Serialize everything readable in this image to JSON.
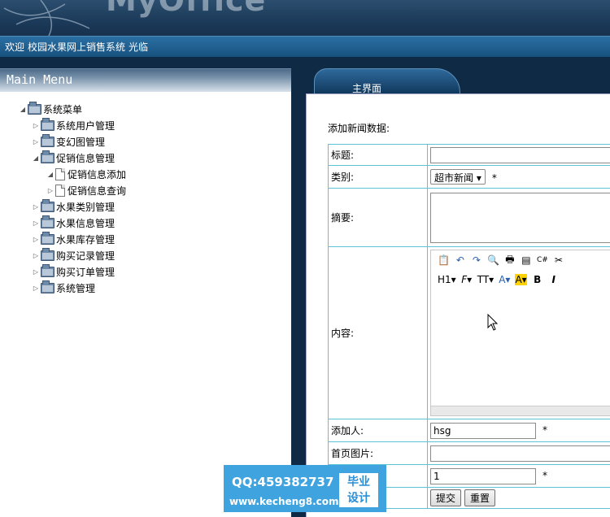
{
  "header": {
    "logo_text": "MyOffice"
  },
  "welcome": {
    "prefix": "欢迎",
    "system": "校园水果网上销售系统",
    "suffix": "光临"
  },
  "menu": {
    "title": "Main Menu",
    "root": "系统菜单",
    "items": [
      {
        "label": "系统用户管理",
        "expanded": false
      },
      {
        "label": "变幻图管理",
        "expanded": false
      },
      {
        "label": "促销信息管理",
        "expanded": true,
        "children": [
          "促销信息添加",
          "促销信息查询"
        ]
      },
      {
        "label": "水果类别管理",
        "expanded": false
      },
      {
        "label": "水果信息管理",
        "expanded": false
      },
      {
        "label": "水果库存管理",
        "expanded": false
      },
      {
        "label": "购买记录管理",
        "expanded": false
      },
      {
        "label": "购买订单管理",
        "expanded": false
      },
      {
        "label": "系统管理",
        "expanded": false
      }
    ]
  },
  "tab": {
    "label": "主界面"
  },
  "form": {
    "caption": "添加新闻数据:",
    "title_label": "标题:",
    "title_value": "",
    "category_label": "类别:",
    "category_value": "超市新闻",
    "summary_label": "摘要:",
    "content_label": "内容:",
    "adder_label": "添加人:",
    "adder_value": "hsg",
    "image_label": "首页图片:",
    "image_value": "",
    "order_value": "1",
    "required_mark": "*",
    "submit_label": "提交",
    "reset_label": "重置"
  },
  "editor": {
    "row2": {
      "heading": "H1",
      "font": "F",
      "size": "TT",
      "font_color": "A",
      "highlight": "A",
      "bold": "B",
      "italic": "I"
    }
  },
  "watermark": {
    "qq": "QQ:459382737",
    "url": "www.kecheng8.com",
    "badge_line1": "毕业",
    "badge_line2": "设计"
  },
  "colors": {
    "header_bg": "#1c3a5a",
    "welcome_bg": "#18527f",
    "table_border": "#5fc3d6",
    "watermark_bg": "#3fa3e0"
  }
}
